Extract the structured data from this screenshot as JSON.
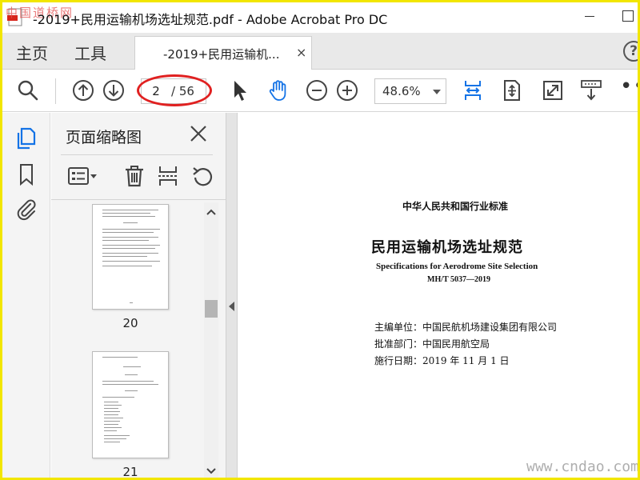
{
  "window": {
    "title": "-2019+民用运输机场选址规范.pdf - Adobe Acrobat Pro DC"
  },
  "watermark": {
    "top_left": "中国道桥网",
    "bottom_right": "www.cndao.com"
  },
  "tabs": {
    "home": "主页",
    "tools": "工具",
    "document": "-2019+民用运输机...",
    "document_close": "×"
  },
  "toolbar": {
    "current_page": "2",
    "total_pages": "/ 56",
    "zoom": "48.6%",
    "highlight_color": "#e02020",
    "accent_color": "#1473e6"
  },
  "left_rail": {
    "icons": [
      "page-thumbnails-icon",
      "bookmark-icon",
      "attachment-icon"
    ]
  },
  "thumbnail_panel": {
    "title": "页面缩略图",
    "thumbnails": [
      {
        "label": "20"
      },
      {
        "label": "21"
      }
    ]
  },
  "document": {
    "header": "中华人民共和国行业标准",
    "title": "民用运输机场选址规范",
    "title_en": "Specifications for Aerodrome Site Selection",
    "code": "MH/T 5037—2019",
    "compiling_unit": "主编单位：中国民航机场建设集团有限公司",
    "approver": "批准部门：中国民用航空局",
    "effective_date": "施行日期：2019 年 11 月 1 日"
  }
}
